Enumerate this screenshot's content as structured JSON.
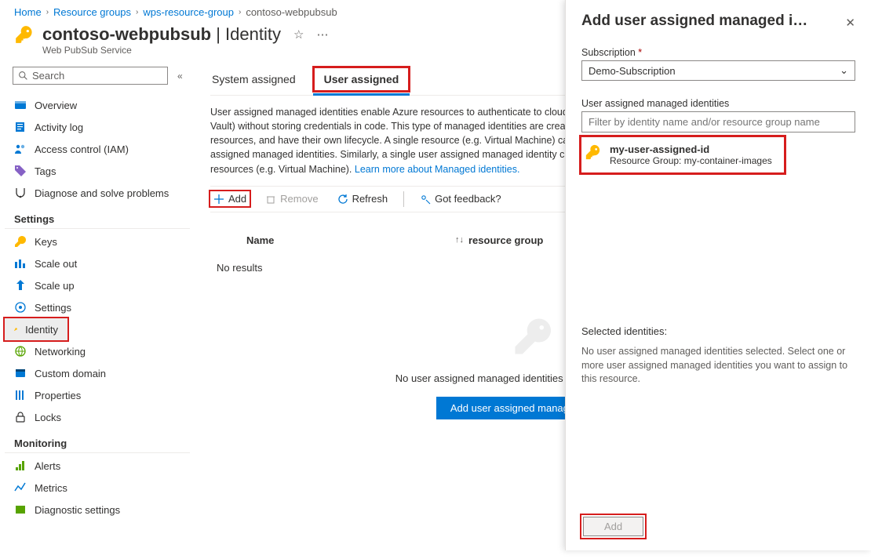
{
  "breadcrumb": [
    {
      "label": "Home"
    },
    {
      "label": "Resource groups"
    },
    {
      "label": "wps-resource-group"
    },
    {
      "label": "contoso-webpubsub"
    }
  ],
  "header": {
    "resource_name": "contoso-webpubsub",
    "section": "Identity",
    "service_type": "Web PubSub Service"
  },
  "sidebar": {
    "search_placeholder": "Search",
    "top_items": [
      {
        "label": "Overview"
      },
      {
        "label": "Activity log"
      },
      {
        "label": "Access control (IAM)"
      },
      {
        "label": "Tags"
      },
      {
        "label": "Diagnose and solve problems"
      }
    ],
    "settings_header": "Settings",
    "settings_items": [
      {
        "label": "Keys"
      },
      {
        "label": "Scale out"
      },
      {
        "label": "Scale up"
      },
      {
        "label": "Settings"
      },
      {
        "label": "Identity"
      },
      {
        "label": "Networking"
      },
      {
        "label": "Custom domain"
      },
      {
        "label": "Properties"
      },
      {
        "label": "Locks"
      }
    ],
    "monitoring_header": "Monitoring",
    "monitoring_items": [
      {
        "label": "Alerts"
      },
      {
        "label": "Metrics"
      },
      {
        "label": "Diagnostic settings"
      }
    ]
  },
  "tabs": {
    "system": "System assigned",
    "user": "User assigned"
  },
  "description": {
    "text": "User assigned managed identities enable Azure resources to authenticate to cloud services (e.g. Azure Key Vault) without storing credentials in code. This type of managed identities are created as standalone Azure resources, and have their own lifecycle. A single resource (e.g. Virtual Machine) can utilize multiple user assigned managed identities. Similarly, a single user assigned managed identity can be shared across multiple resources (e.g. Virtual Machine). ",
    "link": "Learn more about Managed identities."
  },
  "toolbar": {
    "add": "Add",
    "remove": "Remove",
    "refresh": "Refresh",
    "feedback": "Got feedback?"
  },
  "columns": {
    "name": "Name",
    "rg": "resource group"
  },
  "table": {
    "no_results": "No results"
  },
  "empty_state": {
    "text": "No user assigned managed identities found for this resource.",
    "button": "Add user assigned managed identity"
  },
  "panel": {
    "title": "Add user assigned managed i…",
    "subscription_label": "Subscription",
    "subscription_value": "Demo-Subscription",
    "uami_label": "User assigned managed identities",
    "filter_placeholder": "Filter by identity name and/or resource group name",
    "result": {
      "name": "my-user-assigned-id",
      "sub": "Resource Group: my-container-images"
    },
    "selected_header": "Selected identities:",
    "selected_msg": "No user assigned managed identities selected. Select one or more user assigned managed identities you want to assign to this resource.",
    "add_button": "Add"
  }
}
